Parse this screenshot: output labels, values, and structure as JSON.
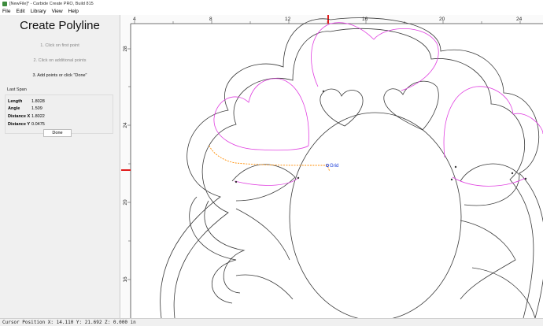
{
  "window": {
    "title": "[NewFile]* - Carbide Create PRO, Build 815"
  },
  "menu": [
    "File",
    "Edit",
    "Library",
    "View",
    "Help"
  ],
  "panel": {
    "heading": "Create Polyline",
    "step1": "1. Click on first point",
    "step2": "2. Click on additional points",
    "step3": "3. Add points or click \"Done\"",
    "last_span_title": "Last Span",
    "last_span": [
      {
        "label": "Length",
        "value": "1.8028"
      },
      {
        "label": "Angle",
        "value": "1.509"
      },
      {
        "label": "Distance X",
        "value": "1.8022"
      },
      {
        "label": "Distance Y",
        "value": "0.0475"
      }
    ],
    "done_label": "Done"
  },
  "canvas": {
    "top_ruler_labels": [
      "4",
      "8",
      "12",
      "16",
      "20",
      "24"
    ],
    "left_ruler_labels": [
      "28",
      "24",
      "20",
      "16"
    ],
    "cursor_label": "Grid",
    "colors": {
      "outline": "#3a3a3a",
      "toolpath": "#e040e0",
      "polyline": "#ff8c00",
      "marker": "#e01b1b",
      "snap_label": "#1a3dd8"
    }
  },
  "status": {
    "text": "Cursor Position X: 14.110 Y: 21.692 Z: 0.000 in"
  }
}
